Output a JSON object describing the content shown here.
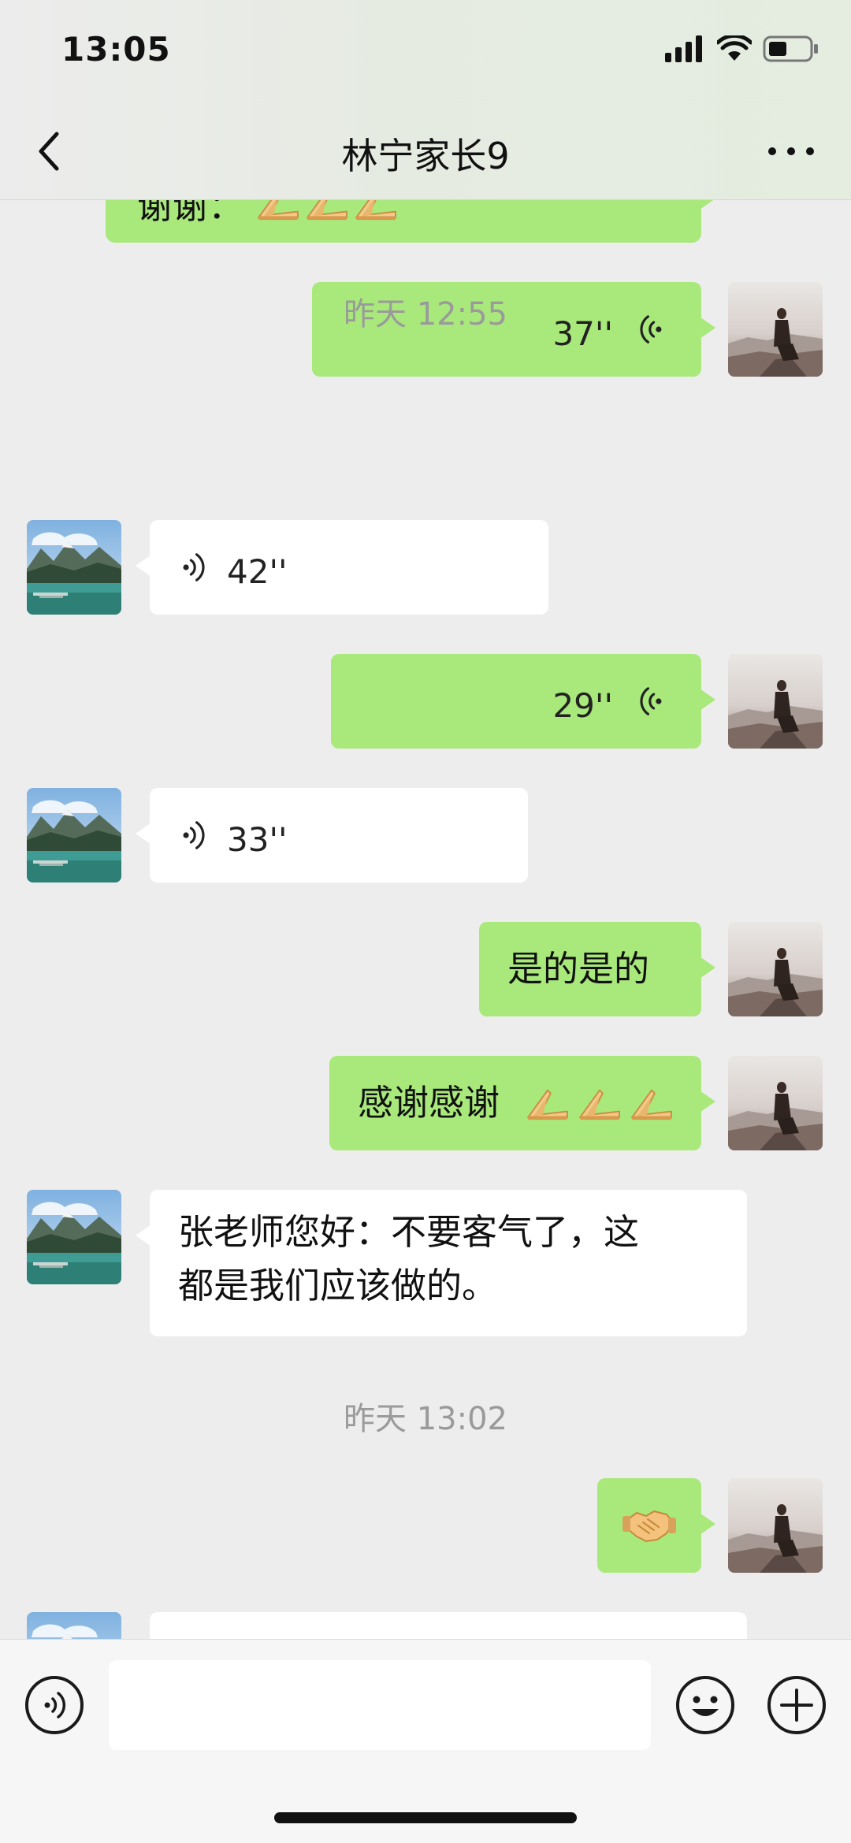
{
  "status_bar": {
    "time": "13:05"
  },
  "header": {
    "title": "林宁家长9"
  },
  "messages": {
    "m0": {
      "text": "谢谢："
    },
    "m1": {
      "duration": "37''"
    },
    "ts1": {
      "text": "昨天 12:55"
    },
    "m2": {
      "duration": "42''"
    },
    "m3": {
      "duration": "29''"
    },
    "m4": {
      "duration": "33''"
    },
    "m5": {
      "text": "是的是的"
    },
    "m6": {
      "text": "感谢感谢"
    },
    "m7": {
      "text": "张老师您好：不要客气了，这\n都是我们应该做的。"
    },
    "ts2": {
      "text": "昨天 13:02"
    },
    "m8": {
      "emoji": "handshake"
    }
  },
  "icons": {
    "back": "chevron-left-icon",
    "more": "more-dots-icon",
    "voice": "voice-icon",
    "emoji": "smiley-icon",
    "plus": "plus-icon",
    "pray": "pray-hands-emoji",
    "handshake": "handshake-emoji"
  },
  "colors": {
    "my_bubble": "#a9e97c",
    "their_bubble": "#ffffff",
    "background": "#ededed",
    "timestamp": "#9a9a9a"
  }
}
